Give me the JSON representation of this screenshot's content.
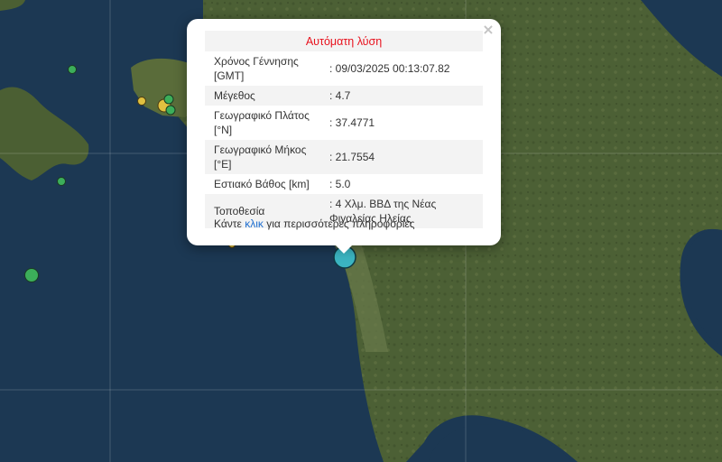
{
  "popup": {
    "title": "Αυτόματη λύση",
    "close_glyph": "×",
    "rows": [
      {
        "label": "Χρόνος Γέννησης [GMT]",
        "value": ": 09/03/2025 00:13:07.82"
      },
      {
        "label": "Μέγεθος",
        "value": ": 4.7"
      },
      {
        "label": "Γεωγραφικό Πλάτος [°N]",
        "value": ": 37.4771"
      },
      {
        "label": "Γεωγραφικό Μήκος [°E]",
        "value": ": 21.7554"
      },
      {
        "label": "Εστιακό Βάθος [km]",
        "value": ": 5.0"
      },
      {
        "label": "Τοποθεσία",
        "value": ": 4 Χλμ. ΒΒΔ της Νέας Φιγαλείας Ηλείας"
      }
    ],
    "more_prefix": "Κάντε ",
    "more_link": "κλικ",
    "more_suffix": " για περισσότερες πληροφορίες"
  },
  "colors": {
    "sea": "#1d3a55",
    "land": "#4b5e34",
    "selected_event": "#3bb4c1",
    "event_green": "#3cae5a",
    "event_yellow": "#e0c040",
    "title_red": "#e8101c",
    "link_blue": "#1f6fd0"
  }
}
